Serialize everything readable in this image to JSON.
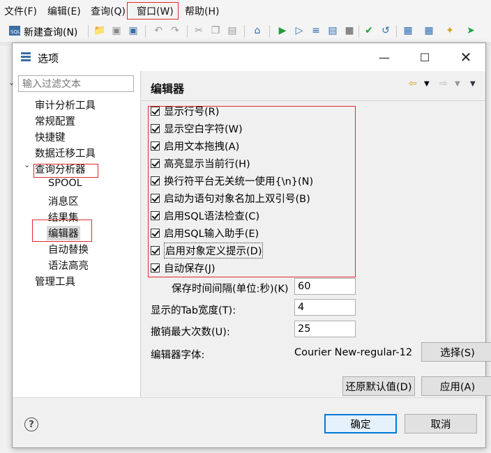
{
  "menubar": {
    "items": [
      "文件(F)",
      "编辑(E)",
      "查询(Q)",
      "窗口(W)",
      "帮助(H)"
    ]
  },
  "toolbar": {
    "new_query_label": "新建查询(N)"
  },
  "dialog": {
    "title": "选项",
    "filter_placeholder": "输入过滤文本",
    "tree": {
      "items": [
        {
          "label": "审计分析工具"
        },
        {
          "label": "常规配置"
        },
        {
          "label": "快捷键"
        },
        {
          "label": "数据迁移工具"
        },
        {
          "label": "查询分析器"
        },
        {
          "label": "SPOOL"
        },
        {
          "label": "消息区"
        },
        {
          "label": "结果集"
        },
        {
          "label": "编辑器"
        },
        {
          "label": "自动替换"
        },
        {
          "label": "语法高亮"
        },
        {
          "label": "管理工具"
        }
      ],
      "selected": "编辑器",
      "expanded": "查询分析器"
    },
    "page_title": "编辑器",
    "checkboxes": [
      {
        "label": "显示行号(R)",
        "checked": true
      },
      {
        "label": "显示空白字符(W)",
        "checked": true
      },
      {
        "label": "启用文本拖拽(A)",
        "checked": true
      },
      {
        "label": "高亮显示当前行(H)",
        "checked": true
      },
      {
        "label": "换行符平台无关统一使用{\\n}(N)",
        "checked": true
      },
      {
        "label": "启动为语句对象名加上双引号(B)",
        "checked": true
      },
      {
        "label": "启用SQL语法检查(C)",
        "checked": true
      },
      {
        "label": "启用SQL输入助手(E)",
        "checked": true
      },
      {
        "label": "启用对象定义提示(D)",
        "checked": true
      },
      {
        "label": "自动保存(J)",
        "checked": true
      }
    ],
    "fields": {
      "save_interval_label": "保存时间间隔(单位:秒)(K)",
      "save_interval_value": "60",
      "tab_width_label": "显示的Tab宽度(T):",
      "tab_width_value": "4",
      "undo_max_label": "撤销最大次数(U):",
      "undo_max_value": "25",
      "font_label": "编辑器字体:",
      "font_value": "Courier New-regular-12",
      "font_button": "选择(S)"
    },
    "buttons": {
      "restore_defaults": "还原默认值(D)",
      "apply": "应用(A)",
      "ok": "确定",
      "cancel": "取消"
    }
  },
  "colors": {
    "highlight_box": "#e0282e",
    "primary_border": "#0078d7"
  }
}
